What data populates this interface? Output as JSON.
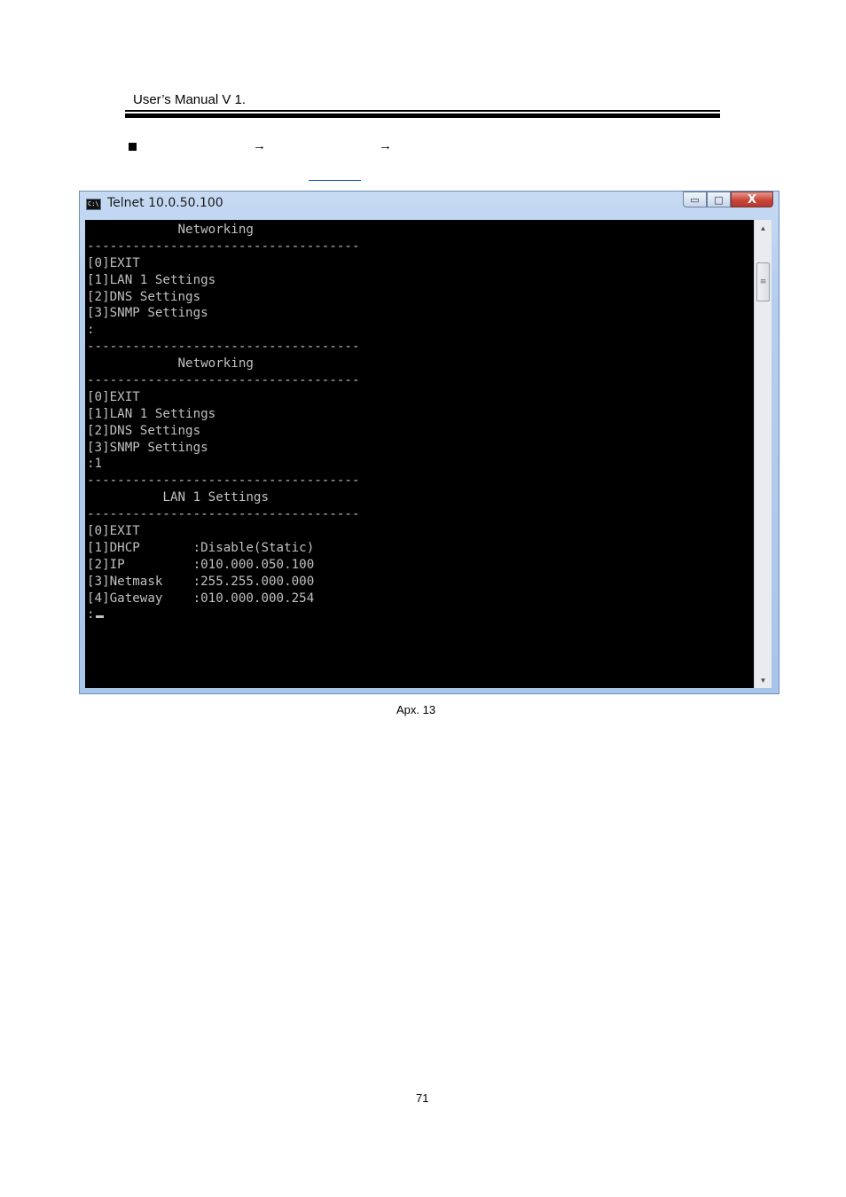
{
  "header": {
    "title": "User’s Manual V 1."
  },
  "instruction": {
    "arrow_1": "→",
    "arrow_2": "→"
  },
  "window": {
    "title": "Telnet 10.0.50.100",
    "icon_text": "C:\\",
    "buttons": {
      "minimize": "▭",
      "maximize": "□",
      "close": "X"
    },
    "scroll": {
      "up": "▲",
      "down": "▼",
      "thumb": "≡"
    },
    "console_lines": [
      "            Networking",
      "------------------------------------",
      "[0]EXIT",
      "[1]LAN 1 Settings",
      "[2]DNS Settings",
      "[3]SNMP Settings",
      ":",
      "------------------------------------",
      "            Networking",
      "------------------------------------",
      "[0]EXIT",
      "[1]LAN 1 Settings",
      "[2]DNS Settings",
      "[3]SNMP Settings",
      ":1",
      "------------------------------------",
      "          LAN 1 Settings",
      "------------------------------------",
      "[0]EXIT",
      "[1]DHCP       :Disable(Static)",
      "[2]IP         :010.000.050.100",
      "[3]Netmask    :255.255.000.000",
      "[4]Gateway    :010.000.000.254",
      ":"
    ]
  },
  "caption": "Apx.    13",
  "page_number": "71"
}
